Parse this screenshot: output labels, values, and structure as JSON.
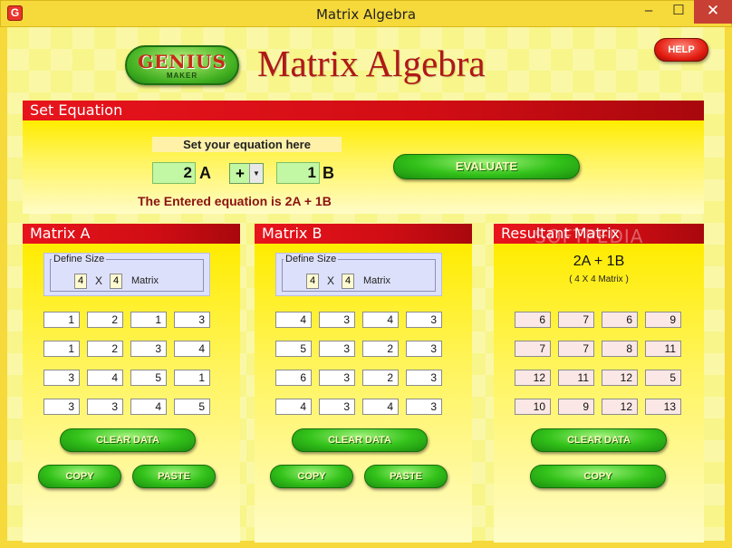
{
  "window": {
    "title": "Matrix Algebra",
    "controls": {
      "minimize": "–",
      "maximize": "☐",
      "close": "✕"
    }
  },
  "header": {
    "logo_main": "GENIUS",
    "logo_sub": "MAKER",
    "app_title": "Matrix Algebra",
    "help_label": "HELP"
  },
  "equation": {
    "section_title": "Set Equation",
    "hint": "Set your equation here",
    "coef_a": "2",
    "var_a": "A",
    "operator": "+",
    "coef_b": "1",
    "var_b": "B",
    "entered_text": "The Entered equation is 2A + 1B",
    "evaluate_label": "EVALUATE"
  },
  "matrix_a": {
    "title": "Matrix A",
    "define_size": "Define Size",
    "rows": "4",
    "cols": "4",
    "x_sep": "X",
    "matrix_word": "Matrix",
    "cells": [
      [
        "1",
        "2",
        "1",
        "3"
      ],
      [
        "1",
        "2",
        "3",
        "4"
      ],
      [
        "3",
        "4",
        "5",
        "1"
      ],
      [
        "3",
        "3",
        "4",
        "5"
      ]
    ],
    "clear_label": "CLEAR DATA",
    "copy_label": "COPY",
    "paste_label": "PASTE"
  },
  "matrix_b": {
    "title": "Matrix B",
    "define_size": "Define Size",
    "rows": "4",
    "cols": "4",
    "x_sep": "X",
    "matrix_word": "Matrix",
    "cells": [
      [
        "4",
        "3",
        "4",
        "3"
      ],
      [
        "5",
        "3",
        "2",
        "3"
      ],
      [
        "6",
        "3",
        "2",
        "3"
      ],
      [
        "4",
        "3",
        "4",
        "3"
      ]
    ],
    "clear_label": "CLEAR DATA",
    "copy_label": "COPY",
    "paste_label": "PASTE"
  },
  "result": {
    "title": "Resultant Matrix",
    "expression": "2A + 1B",
    "size_text": "( 4 X 4 Matrix )",
    "cells": [
      [
        "6",
        "7",
        "6",
        "9"
      ],
      [
        "7",
        "7",
        "8",
        "11"
      ],
      [
        "12",
        "11",
        "12",
        "5"
      ],
      [
        "10",
        "9",
        "12",
        "13"
      ]
    ],
    "clear_label": "CLEAR DATA",
    "copy_label": "COPY"
  },
  "watermark": "SOFTPEDIA"
}
